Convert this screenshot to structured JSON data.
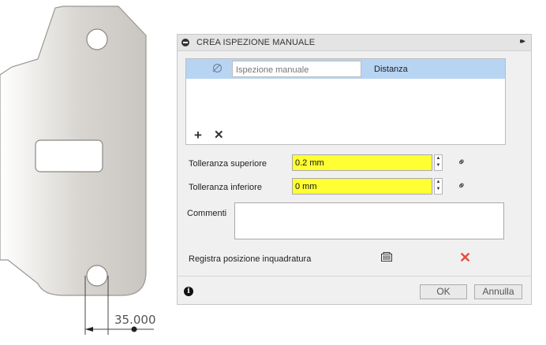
{
  "viewport": {
    "dimension_value": "35.000"
  },
  "dialog": {
    "title": "CREA ISPEZIONE MANUALE",
    "expand_glyph": "▸▸",
    "list": {
      "rows": [
        {
          "name_placeholder": "Ispezione manuale",
          "type": "Distanza"
        }
      ],
      "add_glyph": "+",
      "delete_glyph": "✕"
    },
    "upper_tolerance": {
      "label": "Tolleranza superiore",
      "value": "0.2 mm"
    },
    "lower_tolerance": {
      "label": "Tolleranza inferiore",
      "value": "0 mm"
    },
    "comments": {
      "label": "Commenti",
      "value": ""
    },
    "record_view": {
      "label": "Registra posizione inquadratura"
    },
    "buttons": {
      "ok": "OK",
      "cancel": "Annulla"
    },
    "info_glyph": "i"
  },
  "colors": {
    "highlight_row": "#b7d4f3",
    "input_highlight": "#ffff33",
    "clear_red": "#e74c3c"
  }
}
